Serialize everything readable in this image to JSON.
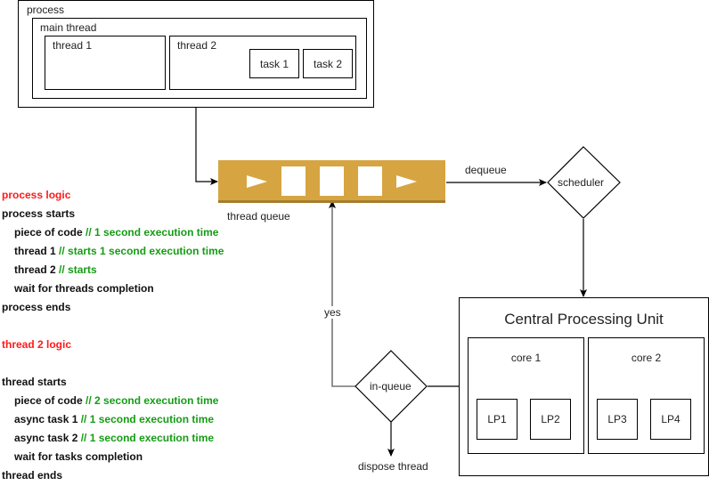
{
  "process": {
    "label": "process",
    "main_thread": {
      "label": "main thread",
      "thread1": {
        "label": "thread 1"
      },
      "thread2": {
        "label": "thread 2",
        "tasks": [
          {
            "label": "task 1"
          },
          {
            "label": "task 2"
          }
        ]
      }
    }
  },
  "queue": {
    "label": "thread queue",
    "color": "#D6A541",
    "border_color": "#A67C2E"
  },
  "edges": {
    "dequeue": "dequeue",
    "yes": "yes",
    "dispose": "dispose thread"
  },
  "scheduler": {
    "label": "scheduler"
  },
  "inqueue": {
    "label": "in-queue"
  },
  "cpu": {
    "title": "Central Processing Unit",
    "cores": [
      {
        "label": "core 1",
        "lps": [
          {
            "label": "LP1"
          },
          {
            "label": "LP2"
          }
        ]
      },
      {
        "label": "core 2",
        "lps": [
          {
            "label": "LP3"
          },
          {
            "label": "LP4"
          }
        ]
      }
    ]
  },
  "process_logic": {
    "heading": "process logic",
    "lines": [
      {
        "text": "process starts",
        "comment": ""
      },
      {
        "text": "piece of code ",
        "comment": "// 1 second execution time"
      },
      {
        "text": "thread 1 ",
        "comment": "// starts 1 second execution time"
      },
      {
        "text": "thread 2 ",
        "comment": "// starts"
      },
      {
        "text": "wait for threads completion",
        "comment": ""
      },
      {
        "text": "process ends",
        "comment": ""
      }
    ]
  },
  "thread2_logic": {
    "heading": "thread 2 logic",
    "lines": [
      {
        "text": "thread starts",
        "comment": ""
      },
      {
        "text": "piece of code ",
        "comment": "// 2 second execution time"
      },
      {
        "text": "async task 1 ",
        "comment": "// 1 second execution time"
      },
      {
        "text": "async task 2 ",
        "comment": "// 1 second execution time"
      },
      {
        "text": "wait for tasks completion",
        "comment": ""
      },
      {
        "text": "thread ends",
        "comment": ""
      }
    ]
  }
}
